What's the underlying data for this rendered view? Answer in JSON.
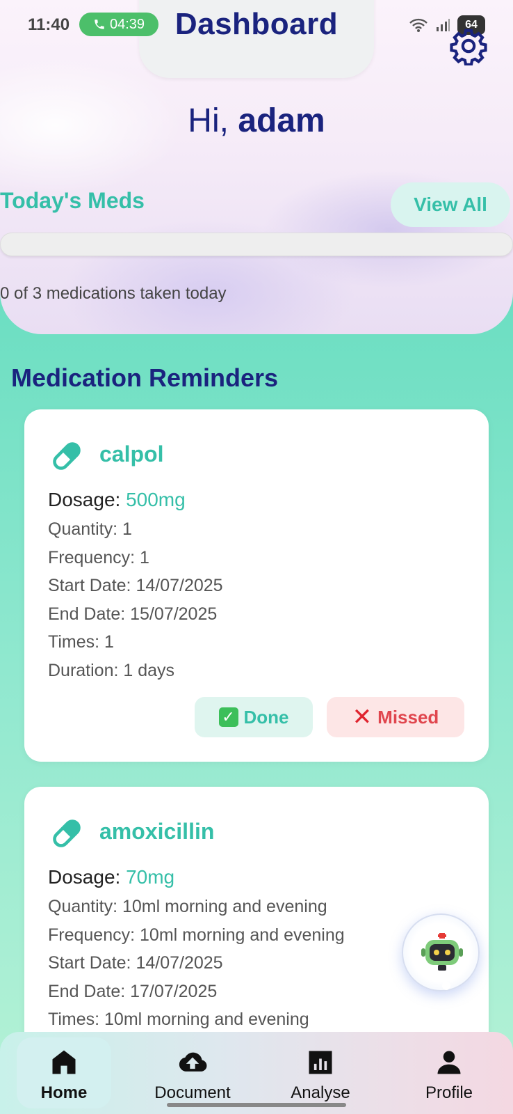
{
  "status_bar": {
    "time": "11:40",
    "call_timer": "04:39",
    "battery": "64"
  },
  "header": {
    "title": "Dashboard",
    "settings_icon": "gear-icon"
  },
  "greeting": {
    "prefix": "Hi,",
    "name": "adam"
  },
  "todays_meds": {
    "title": "Today's Meds",
    "view_all": "View All",
    "progress": 0,
    "summary": "0 of 3 medications taken today"
  },
  "reminders": {
    "title": "Medication Reminders",
    "cards": [
      {
        "name": "calpol",
        "dosage_label": "Dosage:",
        "dosage": "500mg",
        "quantity": "Quantity: 1",
        "frequency": "Frequency: 1",
        "start": "Start Date: 14/07/2025",
        "end": "End Date: 15/07/2025",
        "times": "Times: 1",
        "duration": "Duration: 1 days",
        "done_label": "Done",
        "missed_label": "Missed"
      },
      {
        "name": "amoxicillin",
        "dosage_label": "Dosage:",
        "dosage": "70mg",
        "quantity": "Quantity: 10ml morning and evening",
        "frequency": "Frequency: 10ml morning and evening",
        "start": "Start Date: 14/07/2025",
        "end": "End Date: 17/07/2025",
        "times": "Times: 10ml morning and evening"
      }
    ]
  },
  "nav": {
    "items": [
      {
        "label": "Home",
        "icon": "home-icon",
        "active": true
      },
      {
        "label": "Document",
        "icon": "cloud-upload-icon"
      },
      {
        "label": "Analyse",
        "icon": "bar-chart-icon"
      },
      {
        "label": "Profile",
        "icon": "person-icon"
      }
    ]
  },
  "colors": {
    "navy": "#1a237e",
    "teal": "#35bfa8",
    "red": "#e0464e"
  }
}
